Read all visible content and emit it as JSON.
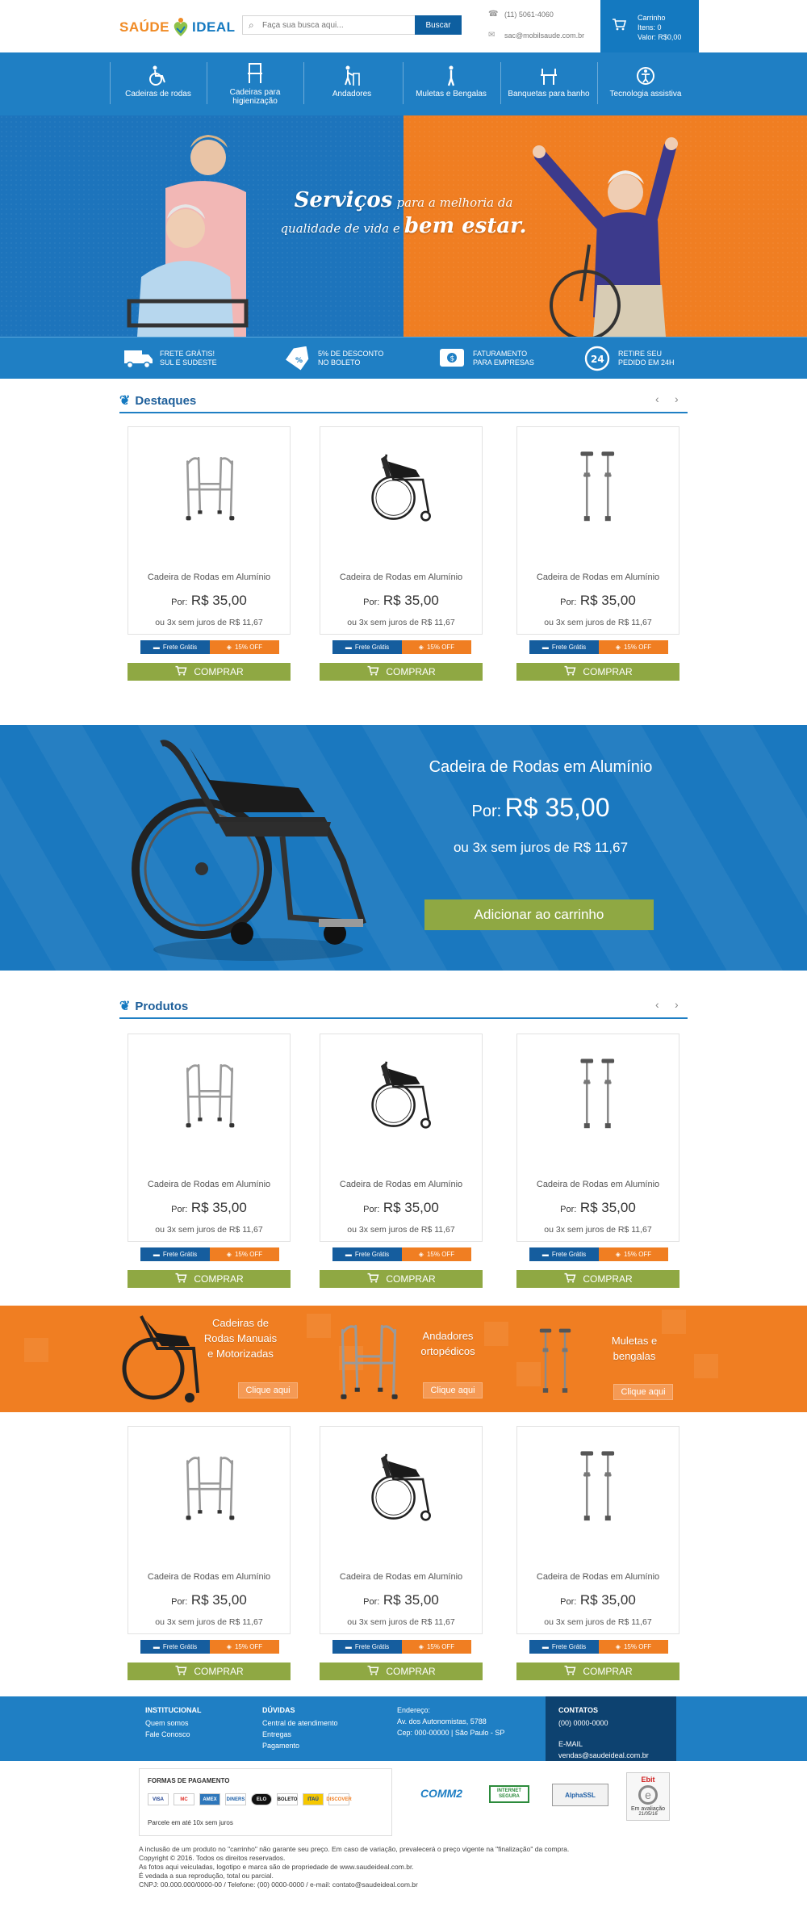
{
  "header": {
    "logo_left": "SAÚDE",
    "logo_right": "IDEAL",
    "search_placeholder": "Faça sua busca aqui...",
    "search_button": "Buscar",
    "phone": "(11) 5061-4060",
    "email": "sac@mobilsaude.com.br",
    "cart_title": "Carrinho",
    "cart_items": "Itens: 0",
    "cart_value": "Valor: R$0,00"
  },
  "nav": {
    "items": [
      {
        "label": "Cadeiras de rodas",
        "icon": "wheelchair-icon"
      },
      {
        "label": "Cadeiras para higienização",
        "icon": "commode-chair-icon"
      },
      {
        "label": "Andadores",
        "icon": "walker-icon"
      },
      {
        "label": "Muletas e Bengalas",
        "icon": "crutch-icon"
      },
      {
        "label": "Banquetas para banho",
        "icon": "bath-stool-icon"
      },
      {
        "label": "Tecnologia assistiva",
        "icon": "assistive-tech-icon"
      }
    ]
  },
  "hero": {
    "line1a": "Serviços",
    "line1b": "para a melhoria da",
    "line2a": "qualidade de vida e",
    "line2b": "bem estar."
  },
  "features": [
    {
      "line1": "FRETE GRÁTIS!",
      "line2": "SUL E SUDESTE",
      "icon": "truck-icon"
    },
    {
      "line1": "5% DE DESCONTO",
      "line2": "NO BOLETO",
      "icon": "discount-tag-icon"
    },
    {
      "line1": "FATURAMENTO",
      "line2": "PARA EMPRESAS",
      "icon": "money-icon"
    },
    {
      "line1": "RETIRE SEU",
      "line2": "PEDIDO EM 24H",
      "icon": "clock-24-icon"
    }
  ],
  "sections": {
    "destaques": "Destaques",
    "produtos": "Produtos",
    "prev": "‹",
    "next": "›"
  },
  "product": {
    "name": "Cadeira de Rodas em Alumínio",
    "price_label": "Por:",
    "price": "R$ 35,00",
    "installments": "ou 3x sem juros de R$ 11,67",
    "badge_shipping": "Frete Grátis",
    "badge_discount": "15% OFF",
    "buy": "COMPRAR"
  },
  "promo": {
    "name": "Cadeira de Rodas em Alumínio",
    "price_label": "Por:",
    "price": "R$ 35,00",
    "installments": "ou 3x sem juros de R$ 11,67",
    "button": "Adicionar ao carrinho"
  },
  "categories": [
    {
      "title1": "Cadeiras de",
      "title2": "Rodas Manuais",
      "title3": "e Motorizadas",
      "button": "Clique aqui"
    },
    {
      "title1": "Andadores",
      "title2": "ortopédicos",
      "title3": "",
      "button": "Clique aqui"
    },
    {
      "title1": "Muletas e",
      "title2": "bengalas",
      "title3": "",
      "button": "Clique aqui"
    }
  ],
  "footer": {
    "col1_title": "INSTITUCIONAL",
    "col1_links": [
      "Quem somos",
      "Fale Conosco"
    ],
    "col2_title": "DÚVIDAS",
    "col2_links": [
      "Central de atendimento",
      "Entregas",
      "Pagamento"
    ],
    "col3_title": "Endereço:",
    "col3_lines": [
      "Av. dos Autonomistas, 5788",
      "Cep: 000-00000 | São Paulo - SP"
    ],
    "contact_title": "CONTATOS",
    "contact_phone": "(00) 0000-0000",
    "contact_email_label": "E-MAIL",
    "contact_email": "vendas@saudeideal.com.br"
  },
  "payment": {
    "title": "FORMAS DE PAGAMENTO",
    "cards": [
      "VISA",
      "MC",
      "AMEX",
      "DINERS",
      "ELO",
      "BOLETO",
      "ITAÚ",
      "DISCOVER"
    ],
    "note": "Parcele em até 10x sem juros"
  },
  "seals": {
    "comm": "COMM2",
    "internet": "INTERNET SEGURA",
    "alpha": "AlphaSSL",
    "ebit": "Ebit",
    "ebit_status": "Em avaliação",
    "ebit_date": "21/05/16"
  },
  "legal": [
    "A inclusão de um produto no \"carrinho\" não garante seu preço. Em caso de variação, prevalecerá o preço vigente na \"finalização\" da compra.",
    "Copyright © 2016. Todos os direitos reservados.",
    "As fotos aqui veiculadas, logotipo e marca são de propriedade de www.saudeideal.com.br.",
    "É vedada a sua reprodução, total ou parcial.",
    "CNPJ: 00.000.000/0000-00 / Telefone: (00) 0000-0000 / e-mail: contato@saudeideal.com.br"
  ],
  "colors": {
    "primary_blue": "#1f7fc4",
    "dark_blue": "#0d4270",
    "orange": "#f07e22",
    "green": "#8fa843"
  }
}
